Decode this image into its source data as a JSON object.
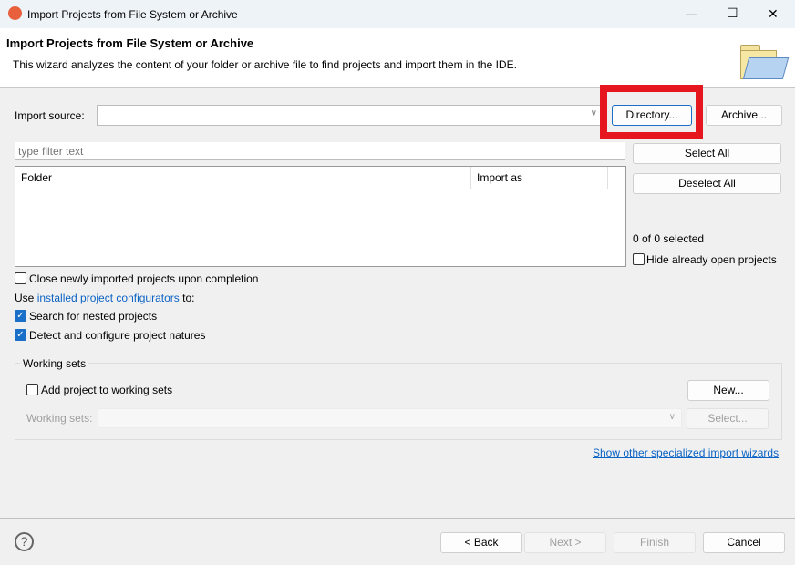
{
  "window": {
    "title": "Import Projects from File System or Archive",
    "minimize": "—",
    "maximize": "☐",
    "close": "✕"
  },
  "header": {
    "title": "Import Projects from File System or Archive",
    "description": "This wizard analyzes the content of your folder or archive file to find projects and import them in the IDE."
  },
  "import_source": {
    "label": "Import source:",
    "value": "",
    "directory_button": "Directory...",
    "archive_button": "Archive..."
  },
  "highlight_color": "#e5161d",
  "filter": {
    "placeholder": "type filter text"
  },
  "table": {
    "columns": [
      "Folder",
      "Import as"
    ],
    "rows": []
  },
  "side": {
    "select_all": "Select All",
    "deselect_all": "Deselect All",
    "selected_count": "0 of 0 selected",
    "hide_open": "Hide already open projects"
  },
  "options": {
    "close_after": "Close newly imported projects upon completion",
    "use_prefix": "Use",
    "configurators_link": "installed project configurators",
    "use_suffix": "to:",
    "search_nested": "Search for nested projects",
    "detect_natures": "Detect and configure project natures"
  },
  "working_sets": {
    "group_label": "Working sets",
    "add_label": "Add project to working sets",
    "new_button": "New...",
    "sets_label": "Working sets:",
    "select_button": "Select..."
  },
  "other_wizards_link": "Show other specialized import wizards",
  "footer": {
    "help": "?",
    "back": "< Back",
    "next": "Next >",
    "finish": "Finish",
    "cancel": "Cancel"
  }
}
